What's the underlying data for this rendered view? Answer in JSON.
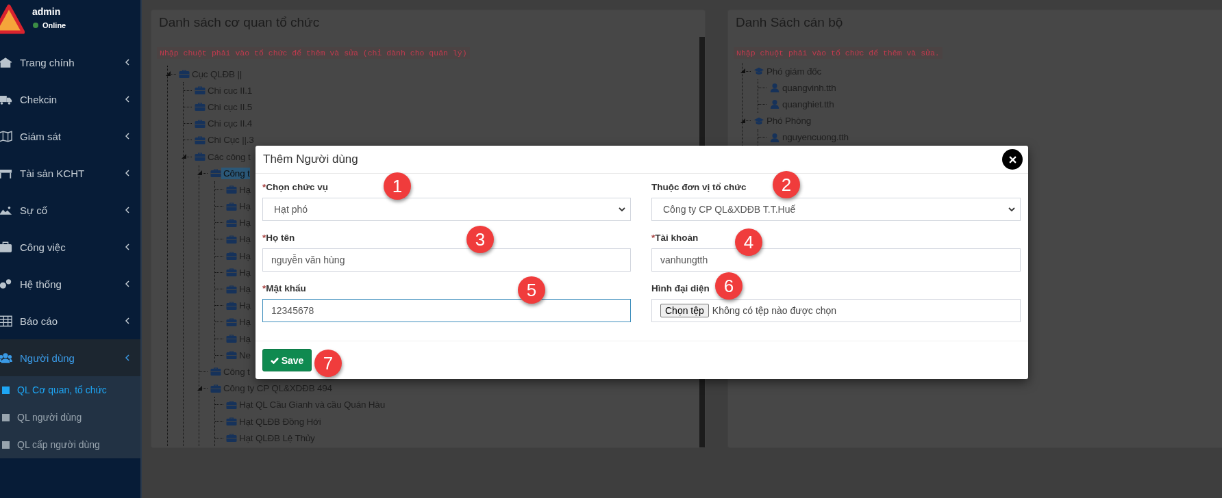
{
  "sidebar": {
    "user": {
      "name": "admin",
      "status": "Online"
    },
    "items": [
      {
        "label": "Trang chính",
        "selected": false
      },
      {
        "label": "Chekcin",
        "selected": false
      },
      {
        "label": "Giám sát",
        "selected": false
      },
      {
        "label": "Tài sản KCHT",
        "selected": false
      },
      {
        "label": "Sự cố",
        "selected": false
      },
      {
        "label": "Công việc",
        "selected": false
      },
      {
        "label": "Hệ thống",
        "selected": false
      },
      {
        "label": "Báo cáo",
        "selected": false
      },
      {
        "label": "Người dùng",
        "selected": true,
        "children": [
          {
            "label": "QL Cơ quan, tổ chức",
            "selected": true
          },
          {
            "label": "QL người dùng",
            "selected": false
          },
          {
            "label": "QL cấp người dùng",
            "selected": false
          }
        ]
      }
    ]
  },
  "org_panel": {
    "title": "Danh sách cơ quan tổ chức",
    "hint": "Nhập chuột phải vào tổ chức để thêm và sửa (chỉ dành cho quản lý)",
    "tree": [
      {
        "label": "Cục QLĐB ||",
        "selected": false,
        "children": [
          {
            "label": "Chi cuc II.1",
            "selected": false
          },
          {
            "label": "Chi cục II.5",
            "selected": false
          },
          {
            "label": "Chi cục II.4",
            "selected": false
          },
          {
            "label": "Chi Cục ||.3",
            "selected": false
          },
          {
            "label": "Các công t",
            "selected": false,
            "children": [
              {
                "label": "Công t",
                "selected": true,
                "children": [
                  {
                    "label": "Hạ",
                    "selected": false
                  },
                  {
                    "label": "Hạ",
                    "selected": false
                  },
                  {
                    "label": "Hạ",
                    "selected": false
                  },
                  {
                    "label": "Hạ",
                    "selected": false
                  },
                  {
                    "label": "Hạ",
                    "selected": false
                  },
                  {
                    "label": "Hạ",
                    "selected": false
                  },
                  {
                    "label": "Hạ",
                    "selected": false
                  },
                  {
                    "label": "Hạ",
                    "selected": false
                  },
                  {
                    "label": "Hạ",
                    "selected": false
                  },
                  {
                    "label": "Hạ",
                    "selected": false
                  },
                  {
                    "label": "Ne",
                    "selected": false
                  }
                ]
              },
              {
                "label": "Công t",
                "selected": false
              },
              {
                "label": "Công ty CP QL&XDĐB 494",
                "selected": false,
                "children": [
                  {
                    "label": "Hạt QL Cầu Gianh và cầu Quán Hàu",
                    "selected": false
                  },
                  {
                    "label": "Hạt QLĐB Đồng Hới",
                    "selected": false
                  },
                  {
                    "label": "Hạt QLĐB Lệ Thủy",
                    "selected": false
                  }
                ]
              }
            ]
          }
        ]
      }
    ]
  },
  "staff_panel": {
    "title": "Danh Sách cán bộ",
    "hint": "Nhập chuột phải vào tổ chức để thêm và sửa.",
    "tree": [
      {
        "label": "Phó giám đốc",
        "selected": false,
        "children": [
          {
            "label": "quangvinh.tth",
            "selected": false
          },
          {
            "label": "quanghiet.tth",
            "selected": false
          }
        ]
      },
      {
        "label": "Phó Phòng",
        "selected": false,
        "children": [
          {
            "label": "nguyencuong.tth",
            "selected": false
          }
        ]
      }
    ]
  },
  "modal": {
    "title": "Thêm Người dùng",
    "fields": [
      {
        "kind": "select",
        "marker": "*",
        "label": "Chọn chức vụ",
        "value": "Hạt phó",
        "focused": false
      },
      {
        "kind": "select",
        "label": "Thuộc đơn vị tổ chức",
        "value": "Công ty CP QL&XDĐB T.T.Huế",
        "focused": false
      },
      {
        "kind": "text",
        "marker": "*",
        "label": "Họ tên",
        "value": "nguyễn văn hùng",
        "focused": false
      },
      {
        "kind": "text",
        "marker": "*",
        "label": "Tài khoản",
        "value": "vanhungtth",
        "focused": false
      },
      {
        "kind": "text",
        "marker": "*",
        "label": "Mật khẩu",
        "value": "12345678",
        "focused": true
      },
      {
        "kind": "file",
        "label": "Hình đại diện",
        "button": "Chọn tệp",
        "value": "Không có tệp nào được chọn",
        "focused": false
      }
    ],
    "save_button": "Save",
    "callouts": [
      "1",
      "2",
      "3",
      "4",
      "5",
      "6",
      "7"
    ]
  }
}
